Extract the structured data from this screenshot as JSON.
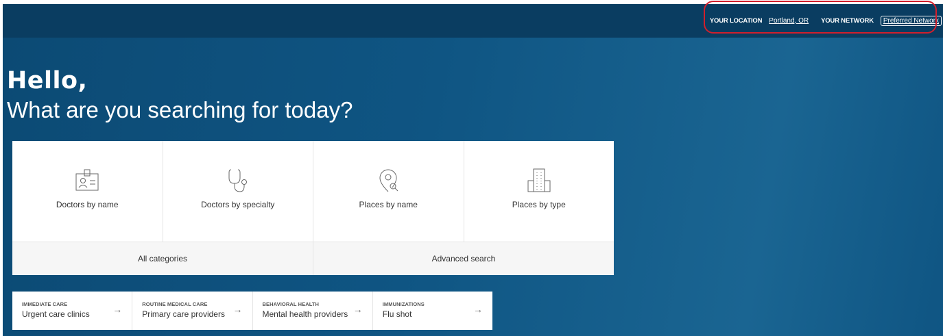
{
  "topbar": {
    "location_label": "YOUR LOCATION",
    "location_value": "Portland, OR",
    "network_label": "YOUR NETWORK",
    "network_value": "Preferred Network"
  },
  "hero": {
    "greeting": "Hello,",
    "question": "What are you searching for today?"
  },
  "search_tiles": [
    {
      "label": "Doctors by name",
      "icon": "id-badge-icon"
    },
    {
      "label": "Doctors by specialty",
      "icon": "stethoscope-icon"
    },
    {
      "label": "Places by name",
      "icon": "location-search-icon"
    },
    {
      "label": "Places by type",
      "icon": "building-icon"
    }
  ],
  "card_links": {
    "all_categories": "All categories",
    "advanced_search": "Advanced search"
  },
  "quick_links": [
    {
      "category": "IMMEDIATE CARE",
      "name": "Urgent care clinics",
      "arrow": "→"
    },
    {
      "category": "ROUTINE MEDICAL CARE",
      "name": "Primary care providers",
      "arrow": "→"
    },
    {
      "category": "BEHAVIORAL HEALTH",
      "name": "Mental health providers",
      "arrow": "→"
    },
    {
      "category": "IMMUNIZATIONS",
      "name": "Flu shot",
      "arrow": "→"
    }
  ],
  "colors": {
    "topbar": "#0a3d61",
    "background": "#0f5583",
    "highlight": "#d21f2c"
  }
}
